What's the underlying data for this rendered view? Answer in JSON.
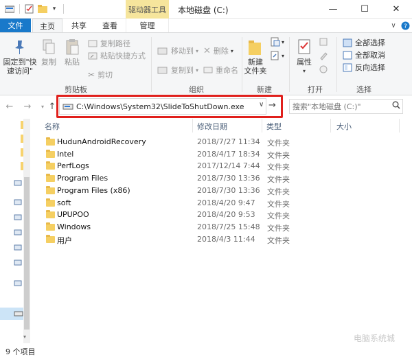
{
  "titlebar": {
    "tool_tab": "驱动器工具",
    "title": "本地磁盘 (C:)",
    "minimize": "—",
    "maximize": "☐",
    "close": "✕"
  },
  "tabs": {
    "file": "文件",
    "home": "主页",
    "share": "共享",
    "view": "查看",
    "manage": "管理",
    "chevron": "∨",
    "help": "?"
  },
  "ribbon": {
    "pin": "固定到\"快\n速访问\"",
    "copy": "复制",
    "paste": "粘贴",
    "copy_path": "复制路径",
    "paste_shortcut": "粘贴快捷方式",
    "cut": "剪切",
    "group_clipboard": "剪贴板",
    "move_to": "移动到",
    "copy_to": "复制到",
    "delete": "删除",
    "rename": "重命名",
    "group_organize": "组织",
    "new_folder": "新建\n文件夹",
    "group_new": "新建",
    "properties": "属性",
    "group_open": "打开",
    "select_all": "全部选择",
    "select_none": "全部取消",
    "invert_select": "反向选择",
    "group_select": "选择"
  },
  "address": {
    "path": "C:\\Windows\\System32\\SlideToShutDown.exe",
    "search_placeholder": "搜索\"本地磁盘 (C:)\""
  },
  "columns": {
    "name": "名称",
    "date": "修改日期",
    "type": "类型",
    "size": "大小"
  },
  "files": [
    {
      "name": "HudunAndroidRecovery",
      "date": "2018/7/27 11:34",
      "type": "文件夹"
    },
    {
      "name": "Intel",
      "date": "2018/4/17 18:34",
      "type": "文件夹"
    },
    {
      "name": "PerfLogs",
      "date": "2017/12/14 7:44",
      "type": "文件夹"
    },
    {
      "name": "Program Files",
      "date": "2018/7/30 13:36",
      "type": "文件夹"
    },
    {
      "name": "Program Files (x86)",
      "date": "2018/7/30 13:36",
      "type": "文件夹"
    },
    {
      "name": "soft",
      "date": "2018/4/20 9:47",
      "type": "文件夹"
    },
    {
      "name": "UPUPOO",
      "date": "2018/4/20 9:53",
      "type": "文件夹"
    },
    {
      "name": "Windows",
      "date": "2018/7/25 15:48",
      "type": "文件夹"
    },
    {
      "name": "用户",
      "date": "2018/4/3 11:44",
      "type": "文件夹"
    }
  ],
  "status": {
    "count": "9 个项目"
  },
  "watermark": "电脑系统城",
  "colors": {
    "accent": "#1979ca",
    "tool_tab": "#f6e59c",
    "highlight": "#e0201c",
    "folder": "#f5cf62"
  }
}
